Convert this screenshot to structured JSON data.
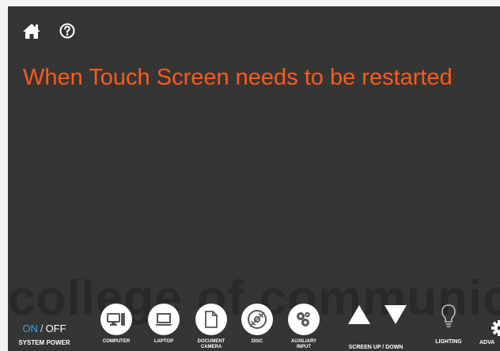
{
  "heading": "When Touch Screen needs to be restarted",
  "watermark": "college of communica",
  "topbar": {
    "icons": [
      "home-icon",
      "help-icon"
    ]
  },
  "power": {
    "on": "ON",
    "separator": "/",
    "off": "OFF",
    "label": "SYSTEM POWER",
    "state": "on"
  },
  "sources": [
    {
      "label": "COMPUTER",
      "icon": "computer-icon"
    },
    {
      "label": "LAPTOP",
      "icon": "laptop-icon"
    },
    {
      "label": "DOCUMENT\nCAMERA",
      "icon": "document-camera-icon"
    },
    {
      "label": "DISC",
      "icon": "disc-icon"
    },
    {
      "label": "AUXILIARY\nINPUT",
      "icon": "auxiliary-input-icon"
    }
  ],
  "screen": {
    "label": "SCREEN UP / DOWN"
  },
  "lighting": {
    "label": "LIGHTING",
    "icon": "lightbulb-icon"
  },
  "advanced": {
    "label": "ADVA",
    "icon": "gear-icon"
  },
  "colors": {
    "heading": "#ff5a1b",
    "power_on": "#3ba7e6",
    "panel": "#333333"
  }
}
